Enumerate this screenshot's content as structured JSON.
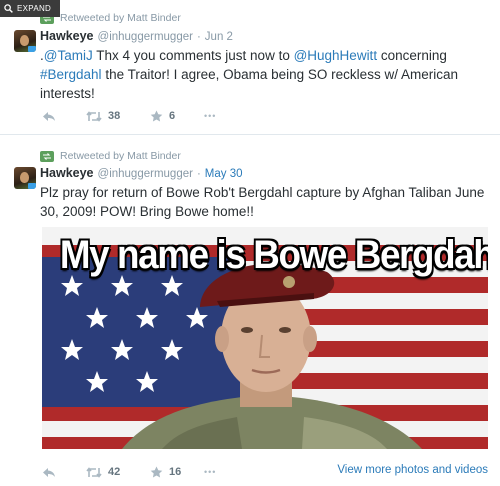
{
  "overlay": {
    "expand_label": "EXPAND"
  },
  "tweets": [
    {
      "retweeted_by": "Retweeted by Matt Binder",
      "name": "Hawkeye",
      "handle": "@inhuggermugger",
      "separator": "·",
      "date": "Jun 2",
      "text_parts": [
        ".",
        "@TamiJ",
        " Thx 4 you comments just now to ",
        "@HughHewitt",
        " concerning ",
        "#Bergdahl",
        " the Traitor! I agree, Obama being SO reckless w/ American interests!"
      ],
      "retweets": "38",
      "favorites": "6",
      "more": "•••"
    },
    {
      "retweeted_by": "Retweeted by Matt Binder",
      "name": "Hawkeye",
      "handle": "@inhuggermugger",
      "separator": "·",
      "date": "May 30",
      "text": "Plz pray for return of Bowe Rob't Bergdahl capture by Afghan Taliban June 30, 2009! POW! Bring Bowe home!!",
      "photo_caption": "My name is Bowe Bergdahl",
      "retweets": "42",
      "favorites": "16",
      "more": "•••",
      "view_more": "View more photos and videos"
    }
  ],
  "colors": {
    "link": "#2b7bb9",
    "muted": "#8899a6",
    "retweet_green": "#5c9f5c"
  },
  "icons": [
    "search-icon",
    "retweet-icon",
    "reply-icon",
    "star-icon",
    "more-icon"
  ]
}
